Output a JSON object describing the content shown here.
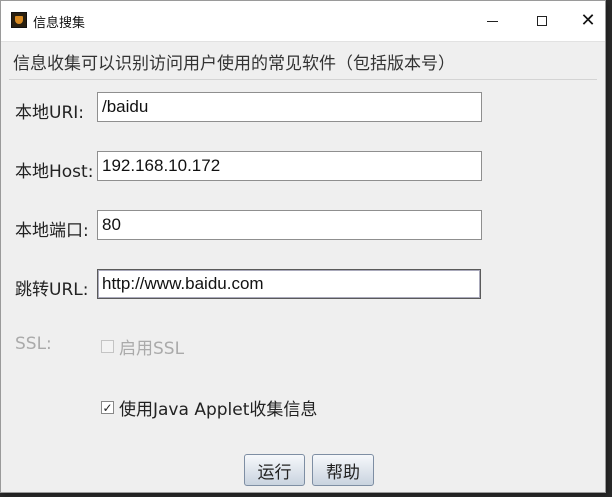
{
  "window": {
    "title": "信息搜集",
    "icon": "java-cup-icon"
  },
  "description": "信息收集可以识别访问用户使用的常见软件（包括版本号）",
  "form": {
    "uri_label": "本地URI:",
    "uri_value": "/baidu",
    "host_label": "本地Host:",
    "host_value": "192.168.10.172",
    "port_label": "本地端口:",
    "port_value": "80",
    "redirect_label": "跳转URL:",
    "redirect_value": "http://www.baidu.com",
    "ssl_label": "SSL:",
    "ssl_checkbox_label": "启用SSL",
    "ssl_enabled": false,
    "applet_checkbox_label": "使用Java Applet收集信息",
    "applet_checked": true
  },
  "buttons": {
    "run": "运行",
    "help": "帮助"
  }
}
